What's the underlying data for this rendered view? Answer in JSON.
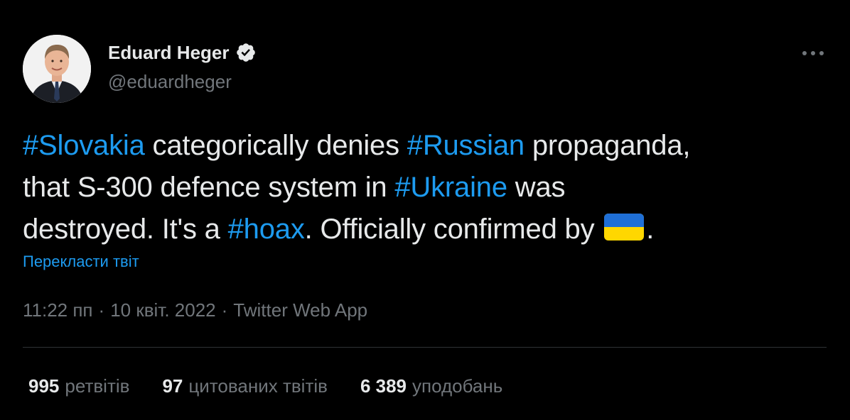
{
  "author": {
    "name": "Eduard Heger",
    "handle": "@eduardheger",
    "verified_icon": "verified-badge-icon",
    "avatar_icon": "profile-photo"
  },
  "more_icon": "more-horizontal-icon",
  "tweet": {
    "segments": [
      {
        "text": "#Slovakia",
        "hashtag": true
      },
      {
        "text": " categorically denies ",
        "hashtag": false
      },
      {
        "text": "#Russian",
        "hashtag": true
      },
      {
        "text": " propaganda,",
        "hashtag": false
      },
      {
        "text": "that S-300 defence system in ",
        "hashtag": false
      },
      {
        "text": "#Ukraine",
        "hashtag": true
      },
      {
        "text": " was",
        "hashtag": false
      },
      {
        "text": "destroyed. It's a ",
        "hashtag": false
      },
      {
        "text": "#hoax",
        "hashtag": true
      },
      {
        "text": ". Officially confirmed by ",
        "hashtag": false
      },
      {
        "text": ".",
        "hashtag": false
      }
    ],
    "flag_icon": "ukraine-flag-emoji"
  },
  "translate_label": "Перекласти твіт",
  "meta": {
    "time": "11:22 пп",
    "date": "10 квіт. 2022",
    "source": "Twitter Web App",
    "separator": "·"
  },
  "stats": {
    "retweets": {
      "count": "995",
      "label": "ретвітів"
    },
    "quotes": {
      "count": "97",
      "label": "цитованих твітів"
    },
    "likes": {
      "count": "6 389",
      "label": "уподобань"
    }
  },
  "colors": {
    "background": "#000000",
    "text": "#e7e9ea",
    "secondary": "#71767b",
    "link": "#1d9bf0",
    "divider": "#2f3336",
    "flag_blue": "#0057b7",
    "flag_yellow": "#ffd700"
  }
}
